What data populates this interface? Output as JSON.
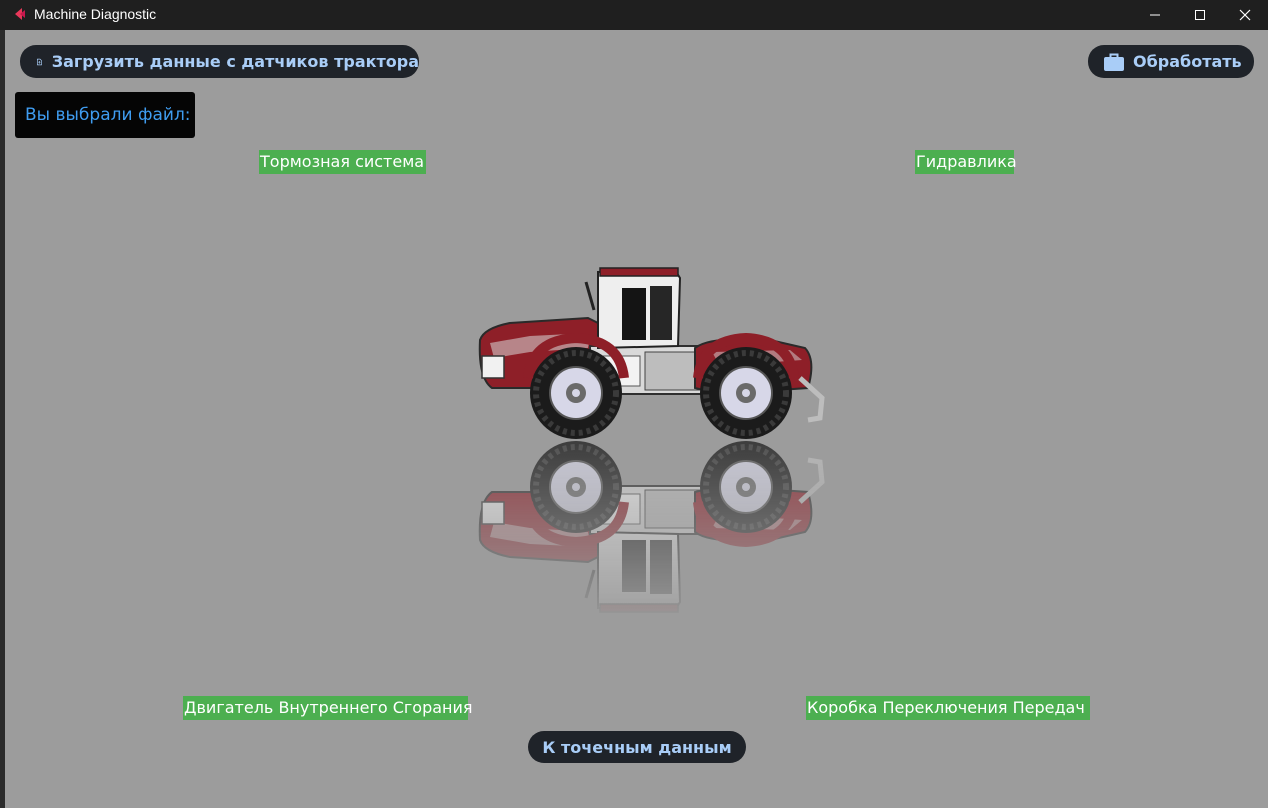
{
  "window": {
    "title": "Machine Diagnostic",
    "controls": [
      "minimize-icon",
      "maximize-icon",
      "close-icon"
    ]
  },
  "toolbar": {
    "upload_label": "Загрузить данные с датчиков трактора",
    "upload_icon": "file-upload-icon",
    "process_label": "Обработать",
    "process_icon": "briefcase-icon"
  },
  "file_label": "Вы выбрали файл:",
  "systems": {
    "brakes": "Тормозная система",
    "hydraulics": "Гидравлика",
    "engine": "Двигатель Внутреннего Сгорания",
    "gearbox": "Коробка Переключения Передач"
  },
  "point_data_button": "К точечным данным",
  "colors": {
    "background": "#9c9c9c",
    "titlebar": "#1f1f1f",
    "button_bg": "#1f2329",
    "button_text": "#a9cdf7",
    "label_green": "#4caf50",
    "file_label_text": "#3f9cf0",
    "tractor_red": "#8e1f28"
  }
}
